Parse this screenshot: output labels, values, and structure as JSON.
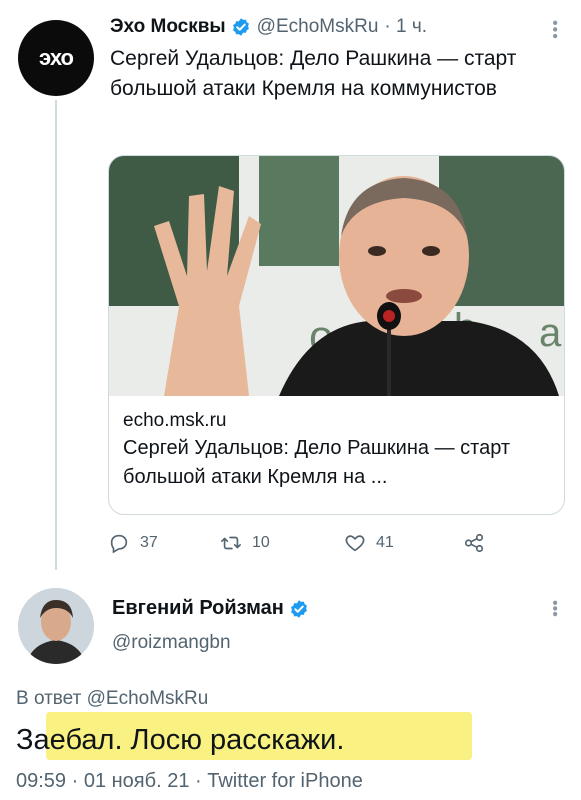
{
  "tweet1": {
    "display_name": "Эхо Москвы",
    "handle": "@EchoMskRu",
    "time": "· 1 ч.",
    "text": "Сергей Удальцов: Дело Рашкина — старт большой атаки Кремля на коммунистов",
    "avatar_logo": "эхо",
    "card": {
      "domain": "echo.msk.ru",
      "title": "Сергей Удальцов: Дело Рашкина — старт большой атаки Кремля на ...",
      "image_letters": [
        "o",
        "b",
        "a"
      ]
    },
    "actions": {
      "reply_count": "37",
      "retweet_count": "10",
      "like_count": "41"
    }
  },
  "tweet2": {
    "display_name": "Евгений Ройзман",
    "handle": "@roizmangbn",
    "reply_to_label": "В ответ",
    "reply_to_handle": "@EchoMskRu",
    "text": "Заебал. Лосю расскажи.",
    "meta": "09:59 · 01 нояб. 21 · Twitter for iPhone"
  },
  "colors": {
    "verified": "#1d9bf0",
    "muted": "#536471",
    "highlight": "#f7ee5a",
    "border": "#cfd9de"
  },
  "icons": [
    "verified-badge-icon",
    "reply-icon",
    "retweet-icon",
    "like-icon",
    "share-icon",
    "more-icon"
  ]
}
